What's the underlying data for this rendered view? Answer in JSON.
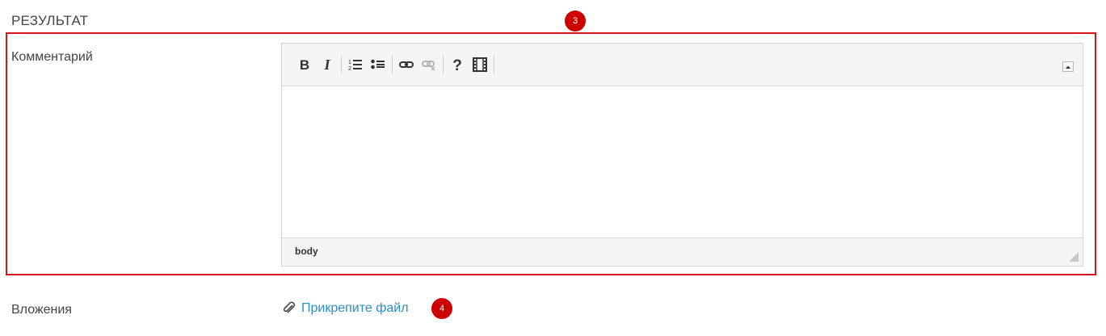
{
  "section": {
    "title": "РЕЗУЛЬТАТ"
  },
  "badges": {
    "comment": "3",
    "attachments": "4"
  },
  "comment": {
    "label": "Комментарий",
    "toolbar": [
      "bold-icon",
      "italic-icon",
      "ordered-list-icon",
      "bullet-list-icon",
      "link-icon",
      "unlink-icon",
      "help-icon",
      "media-icon",
      "collapse-toolbar-icon"
    ],
    "status_path": "body"
  },
  "attachments": {
    "label": "Вложения",
    "link_label": "Прикрепите файл"
  },
  "colors": {
    "highlight": "#d9121b",
    "badge": "#cc0000",
    "link": "#2b8fc7"
  }
}
